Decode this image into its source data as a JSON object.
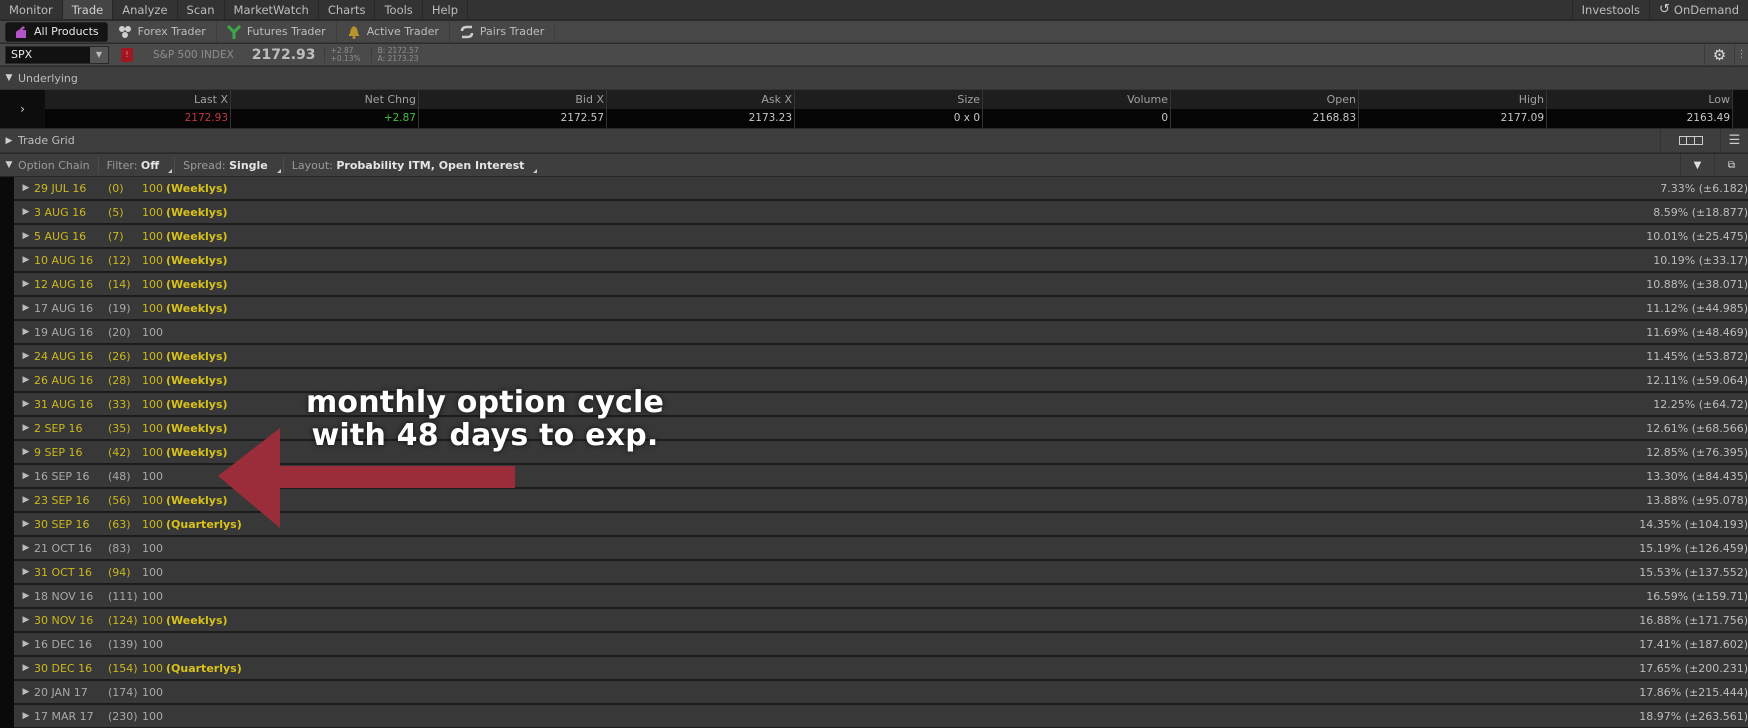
{
  "menu": {
    "items": [
      "Monitor",
      "Trade",
      "Analyze",
      "Scan",
      "MarketWatch",
      "Charts",
      "Tools",
      "Help"
    ],
    "active": "Trade",
    "right_items": [
      {
        "label": "Investools",
        "icon": ""
      },
      {
        "label": "OnDemand",
        "icon": "ondemand-clock-icon"
      }
    ]
  },
  "products": [
    {
      "label": "All Products",
      "icon": "all-products-icon",
      "active": true
    },
    {
      "label": "Forex Trader",
      "icon": "forex-icon",
      "active": false
    },
    {
      "label": "Futures Trader",
      "icon": "futures-icon",
      "active": false
    },
    {
      "label": "Active Trader",
      "icon": "active-trader-bell-icon",
      "active": false
    },
    {
      "label": "Pairs Trader",
      "icon": "pairs-icon",
      "active": false
    }
  ],
  "symbol": {
    "value": "SPX",
    "description": "S&P 500 INDEX",
    "last": "2172.93",
    "net_change": "+2.87",
    "pct_change": "+0.13%",
    "bid": "B: 2172.57",
    "ask": "A: 2173.23"
  },
  "underlying": {
    "title": "Underlying",
    "columns": [
      "Last X",
      "Net Chng",
      "Bid X",
      "Ask X",
      "Size",
      "Volume",
      "Open",
      "High",
      "Low"
    ],
    "values": [
      "2172.93",
      "+2.87",
      "2172.57",
      "2173.23",
      "0 x 0",
      "0",
      "2168.83",
      "2177.09",
      "2163.49"
    ]
  },
  "trade_grid": {
    "title": "Trade Grid"
  },
  "option_chain": {
    "title": "Option Chain",
    "filter_label": "Filter:",
    "filter_value": "Off",
    "spread_label": "Spread:",
    "spread_value": "Single",
    "layout_label": "Layout:",
    "layout_value": "Probability ITM, Open Interest",
    "rows": [
      {
        "date": "29 JUL 16",
        "dte": "(0)",
        "mult": "100",
        "tag": "(Weeklys)",
        "prob": "7.33% (±6.182)",
        "date_y": true
      },
      {
        "date": "3 AUG 16",
        "dte": "(5)",
        "mult": "100",
        "tag": "(Weeklys)",
        "prob": "8.59% (±18.877)",
        "date_y": true
      },
      {
        "date": "5 AUG 16",
        "dte": "(7)",
        "mult": "100",
        "tag": "(Weeklys)",
        "prob": "10.01% (±25.475)",
        "date_y": true
      },
      {
        "date": "10 AUG 16",
        "dte": "(12)",
        "mult": "100",
        "tag": "(Weeklys)",
        "prob": "10.19% (±33.17)",
        "date_y": true
      },
      {
        "date": "12 AUG 16",
        "dte": "(14)",
        "mult": "100",
        "tag": "(Weeklys)",
        "prob": "10.88% (±38.071)",
        "date_y": true
      },
      {
        "date": "17 AUG 16",
        "dte": "(19)",
        "mult": "100",
        "tag": "(Weeklys)",
        "prob": "11.12% (±44.985)",
        "date_y": false
      },
      {
        "date": "19 AUG 16",
        "dte": "(20)",
        "mult": "100",
        "tag": "",
        "prob": "11.69% (±48.469)",
        "date_y": false
      },
      {
        "date": "24 AUG 16",
        "dte": "(26)",
        "mult": "100",
        "tag": "(Weeklys)",
        "prob": "11.45% (±53.872)",
        "date_y": true
      },
      {
        "date": "26 AUG 16",
        "dte": "(28)",
        "mult": "100",
        "tag": "(Weeklys)",
        "prob": "12.11% (±59.064)",
        "date_y": true
      },
      {
        "date": "31 AUG 16",
        "dte": "(33)",
        "mult": "100",
        "tag": "(Weeklys)",
        "prob": "12.25% (±64.72)",
        "date_y": true
      },
      {
        "date": "2 SEP 16",
        "dte": "(35)",
        "mult": "100",
        "tag": "(Weeklys)",
        "prob": "12.61% (±68.566)",
        "date_y": true
      },
      {
        "date": "9 SEP 16",
        "dte": "(42)",
        "mult": "100",
        "tag": "(Weeklys)",
        "prob": "12.85% (±76.395)",
        "date_y": true
      },
      {
        "date": "16 SEP 16",
        "dte": "(48)",
        "mult": "100",
        "tag": "",
        "prob": "13.30% (±84.435)",
        "date_y": false
      },
      {
        "date": "23 SEP 16",
        "dte": "(56)",
        "mult": "100",
        "tag": "(Weeklys)",
        "prob": "13.88% (±95.078)",
        "date_y": true
      },
      {
        "date": "30 SEP 16",
        "dte": "(63)",
        "mult": "100",
        "tag": "(Quarterlys)",
        "prob": "14.35% (±104.193)",
        "date_y": true
      },
      {
        "date": "21 OCT 16",
        "dte": "(83)",
        "mult": "100",
        "tag": "",
        "prob": "15.19% (±126.459)",
        "date_y": false
      },
      {
        "date": "31 OCT 16",
        "dte": "(94)",
        "mult": "100",
        "tag": "",
        "prob": "15.53% (±137.552)",
        "date_y": true
      },
      {
        "date": "18 NOV 16",
        "dte": "(111)",
        "mult": "100",
        "tag": "",
        "prob": "16.59% (±159.71)",
        "date_y": false
      },
      {
        "date": "30 NOV 16",
        "dte": "(124)",
        "mult": "100",
        "tag": "(Weeklys)",
        "prob": "16.88% (±171.756)",
        "date_y": true
      },
      {
        "date": "16 DEC 16",
        "dte": "(139)",
        "mult": "100",
        "tag": "",
        "prob": "17.41% (±187.602)",
        "date_y": false
      },
      {
        "date": "30 DEC 16",
        "dte": "(154)",
        "mult": "100",
        "tag": "(Quarterlys)",
        "prob": "17.65% (±200.231)",
        "date_y": true
      },
      {
        "date": "20 JAN 17",
        "dte": "(174)",
        "mult": "100",
        "tag": "",
        "prob": "17.86% (±215.444)",
        "date_y": false
      },
      {
        "date": "17 MAR 17",
        "dte": "(230)",
        "mult": "100",
        "tag": "",
        "prob": "18.97% (±263.561)",
        "date_y": false
      }
    ]
  },
  "annotation": {
    "line1": "monthly option cycle",
    "line2": "with 48 days to exp.",
    "arrow_color": "#9b2d3a"
  },
  "colors": {
    "weekly_yellow": "#d8c21a",
    "last_red": "#c23745",
    "change_green": "#3fbf3f"
  }
}
